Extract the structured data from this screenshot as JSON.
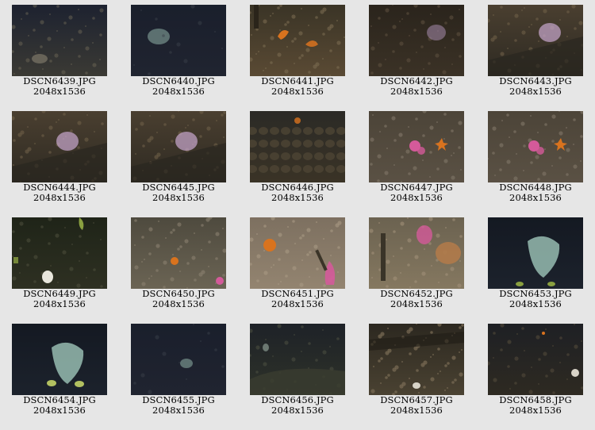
{
  "gallery": {
    "items": [
      {
        "filename": "DSCN6439.JPG",
        "dimensions": "2048x1536",
        "scene": "dark-rocky-floor"
      },
      {
        "filename": "DSCN6440.JPG",
        "dimensions": "2048x1536",
        "scene": "dark-water-sponge"
      },
      {
        "filename": "DSCN6441.JPG",
        "dimensions": "2048x1536",
        "scene": "rocky-orange-coral"
      },
      {
        "filename": "DSCN6442.JPG",
        "dimensions": "2048x1536",
        "scene": "dark-rock-purple"
      },
      {
        "filename": "DSCN6443.JPG",
        "dimensions": "2048x1536",
        "scene": "rock-purple-coral"
      },
      {
        "filename": "DSCN6444.JPG",
        "dimensions": "2048x1536",
        "scene": "rock-purple-coral"
      },
      {
        "filename": "DSCN6445.JPG",
        "dimensions": "2048x1536",
        "scene": "rock-purple-coral"
      },
      {
        "filename": "DSCN6446.JPG",
        "dimensions": "2048x1536",
        "scene": "dark-cobble-floor"
      },
      {
        "filename": "DSCN6447.JPG",
        "dimensions": "2048x1536",
        "scene": "rocks-pink-starfish"
      },
      {
        "filename": "DSCN6448.JPG",
        "dimensions": "2048x1536",
        "scene": "rocks-pink-starfish"
      },
      {
        "filename": "DSCN6449.JPG",
        "dimensions": "2048x1536",
        "scene": "dark-floor-white"
      },
      {
        "filename": "DSCN6450.JPG",
        "dimensions": "2048x1536",
        "scene": "sandy-floor-orange"
      },
      {
        "filename": "DSCN6451.JPG",
        "dimensions": "2048x1536",
        "scene": "sandy-floor-orange-pink"
      },
      {
        "filename": "DSCN6452.JPG",
        "dimensions": "2048x1536",
        "scene": "sandy-rock-pink"
      },
      {
        "filename": "DSCN6453.JPG",
        "dimensions": "2048x1536",
        "scene": "dark-water-sponge-large"
      },
      {
        "filename": "DSCN6454.JPG",
        "dimensions": "2048x1536",
        "scene": "dark-water-sponge-large"
      },
      {
        "filename": "DSCN6455.JPG",
        "dimensions": "2048x1536",
        "scene": "dark-water-sponge"
      },
      {
        "filename": "DSCN6456.JPG",
        "dimensions": "2048x1536",
        "scene": "dark-floor-pale"
      },
      {
        "filename": "DSCN6457.JPG",
        "dimensions": "2048x1536",
        "scene": "rocky-debris"
      },
      {
        "filename": "DSCN6458.JPG",
        "dimensions": "2048x1536",
        "scene": "dark-rock-small"
      }
    ]
  },
  "colors": {
    "background": "#e6e6e6",
    "deep_water": "#1c2030",
    "rock": "#4a4033",
    "sand": "#8a7b66",
    "coral_orange": "#d9731e",
    "coral_pink": "#d45a9a",
    "sponge": "#8fb3a8"
  }
}
